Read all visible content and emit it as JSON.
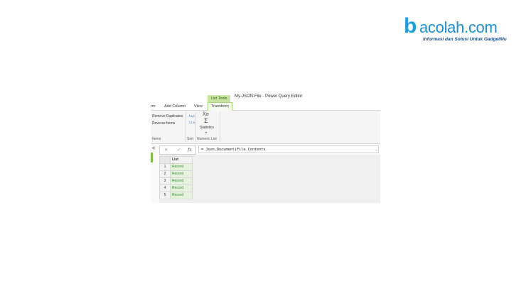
{
  "watermark": {
    "brand_b": "b",
    "brand_word": "acolah.com",
    "tagline": "Informasi dan Solusi Untuk GadgetMu"
  },
  "window": {
    "contextual_tab": "List Tools",
    "title": "My-JSON-File - Power Query Editor"
  },
  "tabs": [
    {
      "label": "rm"
    },
    {
      "label": "Add Column"
    },
    {
      "label": "View"
    },
    {
      "label": "Transform",
      "active": true
    }
  ],
  "ribbon": {
    "remove_duplicates": "Remove Duplicates",
    "reverse_items": "Reverse Items",
    "items_group": "Items",
    "sort_group": "Sort",
    "statistics": "Statistics",
    "statistics_caret": "▾",
    "numeric_list_group": "Numeric List",
    "stat_symbol_top": "X̄σ",
    "stat_symbol_sigma": "Σ"
  },
  "formula_bar": {
    "cancel_glyph": "✕",
    "confirm_glyph": "✓",
    "fx_glyph": "fx",
    "formula": "= Json.Document(File.Contents",
    "expand_glyph": "⌄"
  },
  "side": {
    "collapse_glyph": "<"
  },
  "table": {
    "column_header": "List",
    "rows": [
      {
        "num": "1",
        "value": "Record"
      },
      {
        "num": "2",
        "value": "Record"
      },
      {
        "num": "3",
        "value": "Record"
      },
      {
        "num": "4",
        "value": "Record"
      },
      {
        "num": "5",
        "value": "Record"
      }
    ]
  },
  "colors": {
    "accent_green": "#7cc146",
    "context_tab": "#c8e6a0",
    "record_text": "#2e8b2e",
    "logo_blue": "#1a8fd6"
  }
}
